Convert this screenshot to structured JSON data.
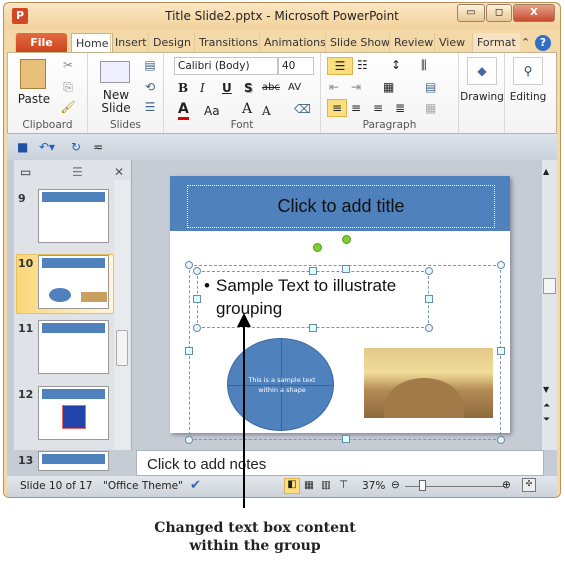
{
  "window": {
    "title": "Title Slide2.pptx  -  Microsoft PowerPoint",
    "minimize": "▭",
    "maximize": "◻",
    "close": "X"
  },
  "tabs": [
    "File",
    "Home",
    "Insert",
    "Design",
    "Transitions",
    "Animations",
    "Slide Show",
    "Review",
    "View",
    "Format"
  ],
  "ribbon": {
    "clipboard": {
      "label": "Clipboard",
      "paste": "Paste"
    },
    "slides": {
      "label": "Slides",
      "new_slide": "New Slide"
    },
    "font": {
      "label": "Font",
      "font_name": "Calibri (Body)",
      "font_size": "40",
      "bold": "B",
      "italic": "I",
      "underline": "U",
      "shadow": "S",
      "strike": "abc",
      "spacing": "AV",
      "color": "A",
      "case": "Aa",
      "grow": "A",
      "shrink": "A"
    },
    "paragraph": {
      "label": "Paragraph"
    },
    "drawing": {
      "label": "Drawing"
    },
    "editing": {
      "label": "Editing"
    }
  },
  "slides_pane": {
    "thumbnails": [
      {
        "number": "9"
      },
      {
        "number": "10",
        "selected": true
      },
      {
        "number": "11"
      },
      {
        "number": "12"
      },
      {
        "number": "13"
      }
    ]
  },
  "slide": {
    "title_placeholder": "Click to add title",
    "bullet_text": "Sample Text to illustrate grouping",
    "shape_text": "This is a sample text within a shape"
  },
  "notes": {
    "placeholder": "Click to add notes"
  },
  "status": {
    "slide_info": "Slide 10 of 17",
    "theme": "\"Office Theme\"",
    "zoom": "37%",
    "zoom_level_percent": 37
  },
  "annotation": {
    "line1": "Changed text box content",
    "line2": "within the group"
  },
  "colors": {
    "accent": "#4f81bd",
    "file_tab": "#d24726",
    "highlight": "#fbdf7f"
  }
}
